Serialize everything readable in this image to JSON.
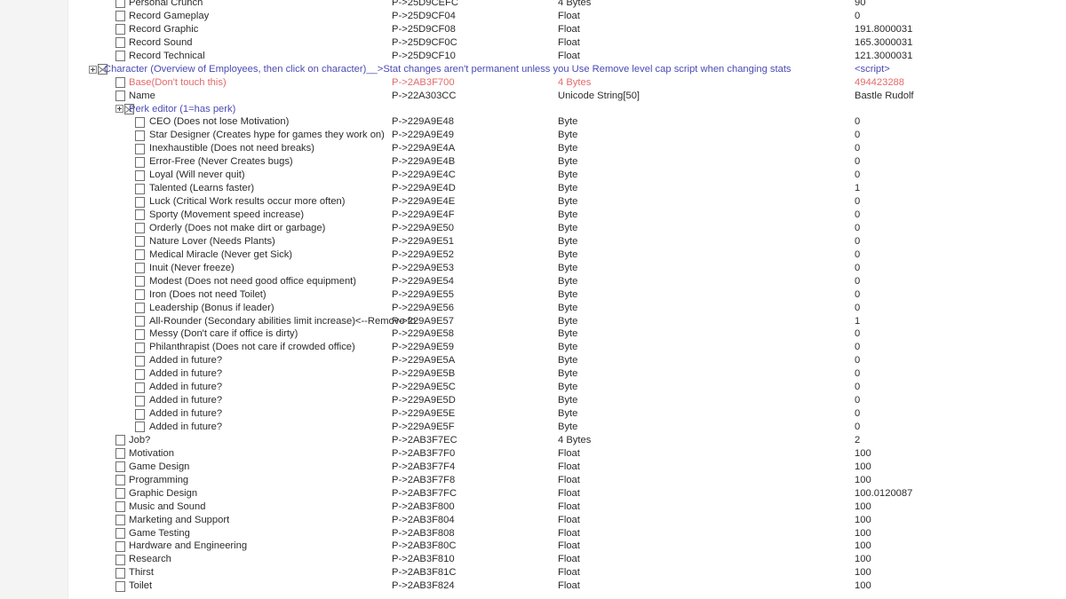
{
  "app": {
    "kind": "memory-table",
    "columns": [
      "Description",
      "Address",
      "Type",
      "Value"
    ],
    "accent_blue": "#4a4ab4",
    "accent_red": "#e36a6a",
    "text_color": "#2b2b2b",
    "gutter_color": "#f4f4f4"
  },
  "rows": [
    {
      "depth": 1,
      "expander": false,
      "checkbox": "empty",
      "desc": "Personal Crunch",
      "addr": "P->25D9CEFC",
      "type": "4 Bytes",
      "value": "90",
      "color": "default",
      "partial_top": true
    },
    {
      "depth": 1,
      "expander": false,
      "checkbox": "empty",
      "desc": "Record Gameplay",
      "addr": "P->25D9CF04",
      "type": "Float",
      "value": "0",
      "color": "default"
    },
    {
      "depth": 1,
      "expander": false,
      "checkbox": "empty",
      "desc": "Record Graphic",
      "addr": "P->25D9CF08",
      "type": "Float",
      "value": "191.8000031",
      "color": "default"
    },
    {
      "depth": 1,
      "expander": false,
      "checkbox": "empty",
      "desc": "Record Sound",
      "addr": "P->25D9CF0C",
      "type": "Float",
      "value": "165.3000031",
      "color": "default"
    },
    {
      "depth": 1,
      "expander": false,
      "checkbox": "empty",
      "desc": "Record Technical",
      "addr": "P->25D9CF10",
      "type": "Float",
      "value": "121.3000031",
      "color": "default"
    },
    {
      "depth": 0,
      "expander": true,
      "checkbox": "x",
      "desc": "Character (Overview of Employees, then click on character)__>Stat changes aren't permanent unless you Use Remove level cap script when changing stats",
      "addr": "",
      "type": "",
      "value": "<script>",
      "color": "blue"
    },
    {
      "depth": 1,
      "expander": false,
      "checkbox": "empty",
      "desc": "Base(Don't touch this)",
      "addr": "P->2AB3F700",
      "type": "4 Bytes",
      "value": "494423288",
      "color": "red"
    },
    {
      "depth": 1,
      "expander": false,
      "checkbox": "empty",
      "desc": "Name",
      "addr": "P->22A303CC",
      "type": "Unicode String[50]",
      "value": "Bastle Rudolf",
      "color": "default"
    },
    {
      "depth": 1,
      "expander": true,
      "checkbox": "x",
      "desc": "Perk editor (1=has perk)",
      "addr": "",
      "type": "",
      "value": "",
      "color": "blue"
    },
    {
      "depth": 2,
      "expander": false,
      "checkbox": "empty",
      "desc": "CEO (Does not lose Motivation)",
      "addr": "P->229A9E48",
      "type": "Byte",
      "value": "0",
      "color": "default"
    },
    {
      "depth": 2,
      "expander": false,
      "checkbox": "empty",
      "desc": "Star Designer (Creates hype for games they work on)",
      "addr": "P->229A9E49",
      "type": "Byte",
      "value": "0",
      "color": "default"
    },
    {
      "depth": 2,
      "expander": false,
      "checkbox": "empty",
      "desc": "Inexhaustible (Does not need breaks)",
      "addr": "P->229A9E4A",
      "type": "Byte",
      "value": "0",
      "color": "default"
    },
    {
      "depth": 2,
      "expander": false,
      "checkbox": "empty",
      "desc": "Error-Free (Never Creates bugs)",
      "addr": "P->229A9E4B",
      "type": "Byte",
      "value": "0",
      "color": "default"
    },
    {
      "depth": 2,
      "expander": false,
      "checkbox": "empty",
      "desc": "Loyal (Will never quit)",
      "addr": "P->229A9E4C",
      "type": "Byte",
      "value": "0",
      "color": "default"
    },
    {
      "depth": 2,
      "expander": false,
      "checkbox": "empty",
      "desc": "Talented (Learns faster)",
      "addr": "P->229A9E4D",
      "type": "Byte",
      "value": "1",
      "color": "default"
    },
    {
      "depth": 2,
      "expander": false,
      "checkbox": "empty",
      "desc": "Luck (Critical Work results occur more often)",
      "addr": "P->229A9E4E",
      "type": "Byte",
      "value": "0",
      "color": "default"
    },
    {
      "depth": 2,
      "expander": false,
      "checkbox": "empty",
      "desc": "Sporty (Movement speed increase)",
      "addr": "P->229A9E4F",
      "type": "Byte",
      "value": "0",
      "color": "default"
    },
    {
      "depth": 2,
      "expander": false,
      "checkbox": "empty",
      "desc": "Orderly (Does not make dirt or garbage)",
      "addr": "P->229A9E50",
      "type": "Byte",
      "value": "0",
      "color": "default"
    },
    {
      "depth": 2,
      "expander": false,
      "checkbox": "empty",
      "desc": "Nature Lover (Needs Plants)",
      "addr": "P->229A9E51",
      "type": "Byte",
      "value": "0",
      "color": "default"
    },
    {
      "depth": 2,
      "expander": false,
      "checkbox": "empty",
      "desc": "Medical Miracle (Never get Sick)",
      "addr": "P->229A9E52",
      "type": "Byte",
      "value": "0",
      "color": "default"
    },
    {
      "depth": 2,
      "expander": false,
      "checkbox": "empty",
      "desc": "Inuit (Never freeze)",
      "addr": "P->229A9E53",
      "type": "Byte",
      "value": "0",
      "color": "default"
    },
    {
      "depth": 2,
      "expander": false,
      "checkbox": "empty",
      "desc": "Modest (Does not need good office equipment)",
      "addr": "P->229A9E54",
      "type": "Byte",
      "value": "0",
      "color": "default"
    },
    {
      "depth": 2,
      "expander": false,
      "checkbox": "empty",
      "desc": "Iron (Does not need Toilet)",
      "addr": "P->229A9E55",
      "type": "Byte",
      "value": "0",
      "color": "default"
    },
    {
      "depth": 2,
      "expander": false,
      "checkbox": "empty",
      "desc": "Leadership (Bonus if leader)",
      "addr": "P->229A9E56",
      "type": "Byte",
      "value": "0",
      "color": "default"
    },
    {
      "depth": 2,
      "expander": false,
      "checkbox": "empty",
      "desc": "All-Rounder (Secondary abilities limit increase)<--Remove for Rer",
      "addr": "P->229A9E57",
      "type": "Byte",
      "value": "1",
      "color": "default",
      "clip": true
    },
    {
      "depth": 2,
      "expander": false,
      "checkbox": "empty",
      "desc": "Messy (Don't care if office is dirty)",
      "addr": "P->229A9E58",
      "type": "Byte",
      "value": "0",
      "color": "default"
    },
    {
      "depth": 2,
      "expander": false,
      "checkbox": "empty",
      "desc": "Philanthrapist (Does not care if crowded office)",
      "addr": "P->229A9E59",
      "type": "Byte",
      "value": "0",
      "color": "default"
    },
    {
      "depth": 2,
      "expander": false,
      "checkbox": "empty",
      "desc": "Added in future?",
      "addr": "P->229A9E5A",
      "type": "Byte",
      "value": "0",
      "color": "default"
    },
    {
      "depth": 2,
      "expander": false,
      "checkbox": "empty",
      "desc": "Added in future?",
      "addr": "P->229A9E5B",
      "type": "Byte",
      "value": "0",
      "color": "default"
    },
    {
      "depth": 2,
      "expander": false,
      "checkbox": "empty",
      "desc": "Added in future?",
      "addr": "P->229A9E5C",
      "type": "Byte",
      "value": "0",
      "color": "default"
    },
    {
      "depth": 2,
      "expander": false,
      "checkbox": "empty",
      "desc": "Added in future?",
      "addr": "P->229A9E5D",
      "type": "Byte",
      "value": "0",
      "color": "default"
    },
    {
      "depth": 2,
      "expander": false,
      "checkbox": "empty",
      "desc": "Added in future?",
      "addr": "P->229A9E5E",
      "type": "Byte",
      "value": "0",
      "color": "default"
    },
    {
      "depth": 2,
      "expander": false,
      "checkbox": "empty",
      "desc": "Added in future?",
      "addr": "P->229A9E5F",
      "type": "Byte",
      "value": "0",
      "color": "default"
    },
    {
      "depth": 1,
      "expander": false,
      "checkbox": "empty",
      "desc": "Job?",
      "addr": "P->2AB3F7EC",
      "type": "4 Bytes",
      "value": "2",
      "color": "default"
    },
    {
      "depth": 1,
      "expander": false,
      "checkbox": "empty",
      "desc": "Motivation",
      "addr": "P->2AB3F7F0",
      "type": "Float",
      "value": "100",
      "color": "default"
    },
    {
      "depth": 1,
      "expander": false,
      "checkbox": "empty",
      "desc": "Game Design",
      "addr": "P->2AB3F7F4",
      "type": "Float",
      "value": "100",
      "color": "default"
    },
    {
      "depth": 1,
      "expander": false,
      "checkbox": "empty",
      "desc": "Programming",
      "addr": "P->2AB3F7F8",
      "type": "Float",
      "value": "100",
      "color": "default"
    },
    {
      "depth": 1,
      "expander": false,
      "checkbox": "empty",
      "desc": "Graphic Design",
      "addr": "P->2AB3F7FC",
      "type": "Float",
      "value": "100.0120087",
      "color": "default"
    },
    {
      "depth": 1,
      "expander": false,
      "checkbox": "empty",
      "desc": "Music and Sound",
      "addr": "P->2AB3F800",
      "type": "Float",
      "value": "100",
      "color": "default"
    },
    {
      "depth": 1,
      "expander": false,
      "checkbox": "empty",
      "desc": "Marketing and Support",
      "addr": "P->2AB3F804",
      "type": "Float",
      "value": "100",
      "color": "default"
    },
    {
      "depth": 1,
      "expander": false,
      "checkbox": "empty",
      "desc": "Game Testing",
      "addr": "P->2AB3F808",
      "type": "Float",
      "value": "100",
      "color": "default"
    },
    {
      "depth": 1,
      "expander": false,
      "checkbox": "empty",
      "desc": "Hardware and Engineering",
      "addr": "P->2AB3F80C",
      "type": "Float",
      "value": "100",
      "color": "default"
    },
    {
      "depth": 1,
      "expander": false,
      "checkbox": "empty",
      "desc": "Research",
      "addr": "P->2AB3F810",
      "type": "Float",
      "value": "100",
      "color": "default"
    },
    {
      "depth": 1,
      "expander": false,
      "checkbox": "empty",
      "desc": "Thirst",
      "addr": "P->2AB3F81C",
      "type": "Float",
      "value": "100",
      "color": "default"
    },
    {
      "depth": 1,
      "expander": false,
      "checkbox": "empty",
      "desc": "Toilet",
      "addr": "P->2AB3F824",
      "type": "Float",
      "value": "100",
      "color": "default"
    }
  ]
}
